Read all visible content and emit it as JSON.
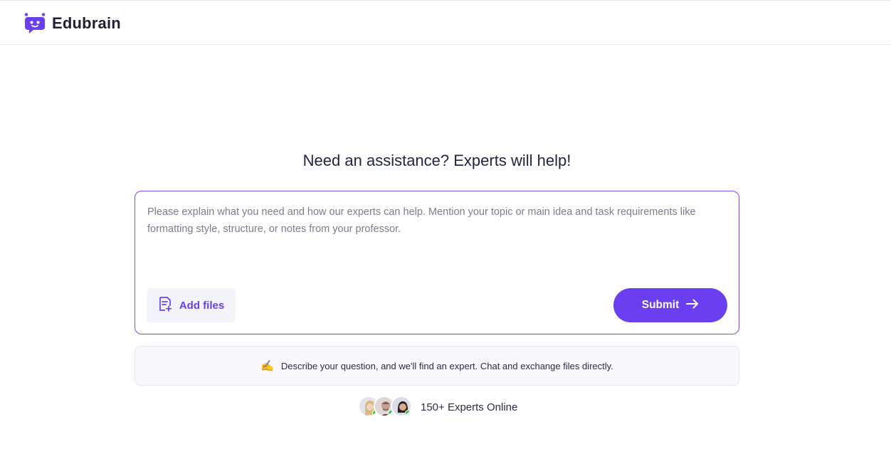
{
  "brand": {
    "name": "Edubrain",
    "logo_icon": "robot-chat-logo",
    "accent": "#6a3ff0"
  },
  "headline": "Need an assistance? Experts will help!",
  "composer": {
    "placeholder": "Please explain what you need and how our experts can help. Mention your topic or main idea and task requirements like formatting style, structure, or notes from your professor.",
    "value": "",
    "add_files_label": "Add files",
    "add_files_icon": "file-plus-icon",
    "submit_label": "Submit",
    "submit_icon": "arrow-right-icon"
  },
  "info": {
    "emoji": "✍️",
    "text": "Describe your question, and we'll find an expert. Chat and exchange files directly."
  },
  "experts": {
    "label": "150+ Experts Online",
    "avatars": [
      "expert-avatar-1",
      "expert-avatar-2",
      "expert-avatar-3"
    ],
    "online_color": "#2ecc40"
  }
}
